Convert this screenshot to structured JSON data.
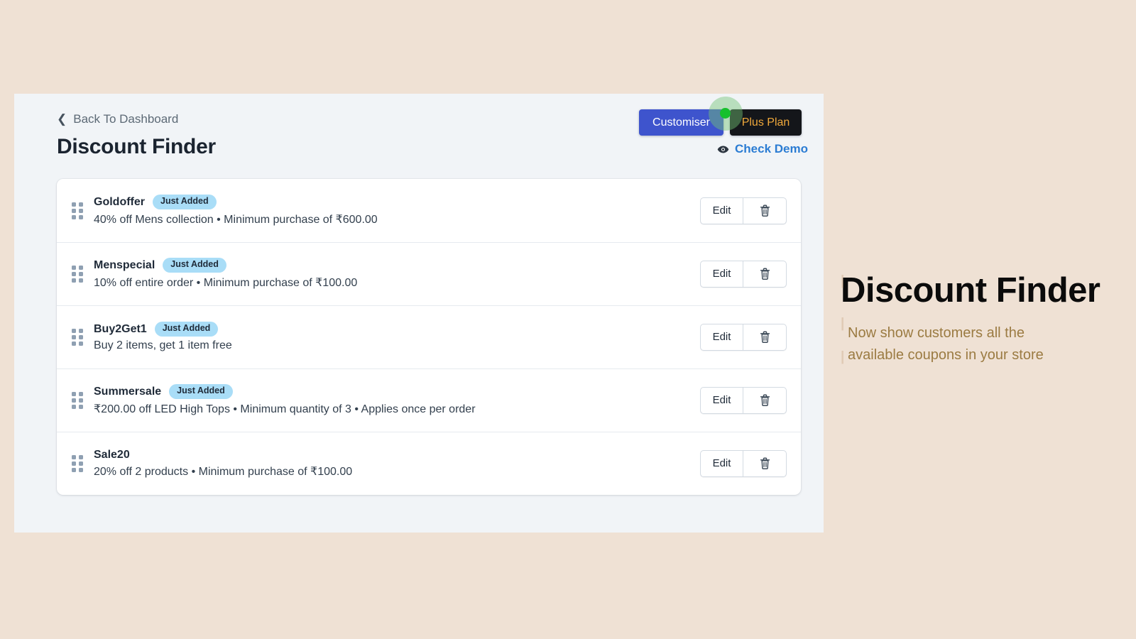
{
  "window": {
    "back_link": {
      "label": "Back To Dashboard",
      "icon": "chevron-left-icon"
    },
    "page_title": "Discount Finder",
    "header_buttons": {
      "customiser": {
        "label": "Customiser",
        "bg_color": "#3E54CD",
        "text_color": "#FFFFFF"
      },
      "plus_plan": {
        "label": "Plus Plan",
        "bg_color": "#14161A",
        "text_color": "#F0A93B"
      }
    },
    "check_demo": {
      "label": "Check Demo",
      "icon": "eye-icon",
      "color": "#2B7CD3"
    },
    "cursor": {
      "icon": "cursor-pointer-dot",
      "color": "#16C02D"
    }
  },
  "discount_list": {
    "row_action_labels": {
      "edit": "Edit",
      "delete_icon": "trash-icon"
    },
    "badge_label": "Just Added",
    "badge_color": "#A9DDF7",
    "rows": [
      {
        "title": "Goldoffer",
        "badge": "Just Added",
        "description": "40% off Mens collection • Minimum purchase of ₹600.00"
      },
      {
        "title": "Menspecial",
        "badge": "Just Added",
        "description": "10% off entire order • Minimum purchase of ₹100.00"
      },
      {
        "title": "Buy2Get1",
        "badge": "Just Added",
        "description": "Buy 2 items, get 1 item free"
      },
      {
        "title": "Summersale",
        "badge": "Just Added",
        "description": "₹200.00 off LED High Tops • Minimum quantity of 3 • Applies once per order"
      },
      {
        "title": "Sale20",
        "badge": "",
        "description": "20% off 2 products • Minimum purchase of ₹100.00"
      }
    ]
  },
  "promo": {
    "title": "Discount Finder",
    "subtitle": "Now show customers all the available coupons in your store",
    "title_color": "#0B0B0B",
    "subtitle_color": "#9B7B42",
    "background_color": "#EFE1D4",
    "ghost_marks": [
      "|",
      "|",
      "|"
    ]
  }
}
